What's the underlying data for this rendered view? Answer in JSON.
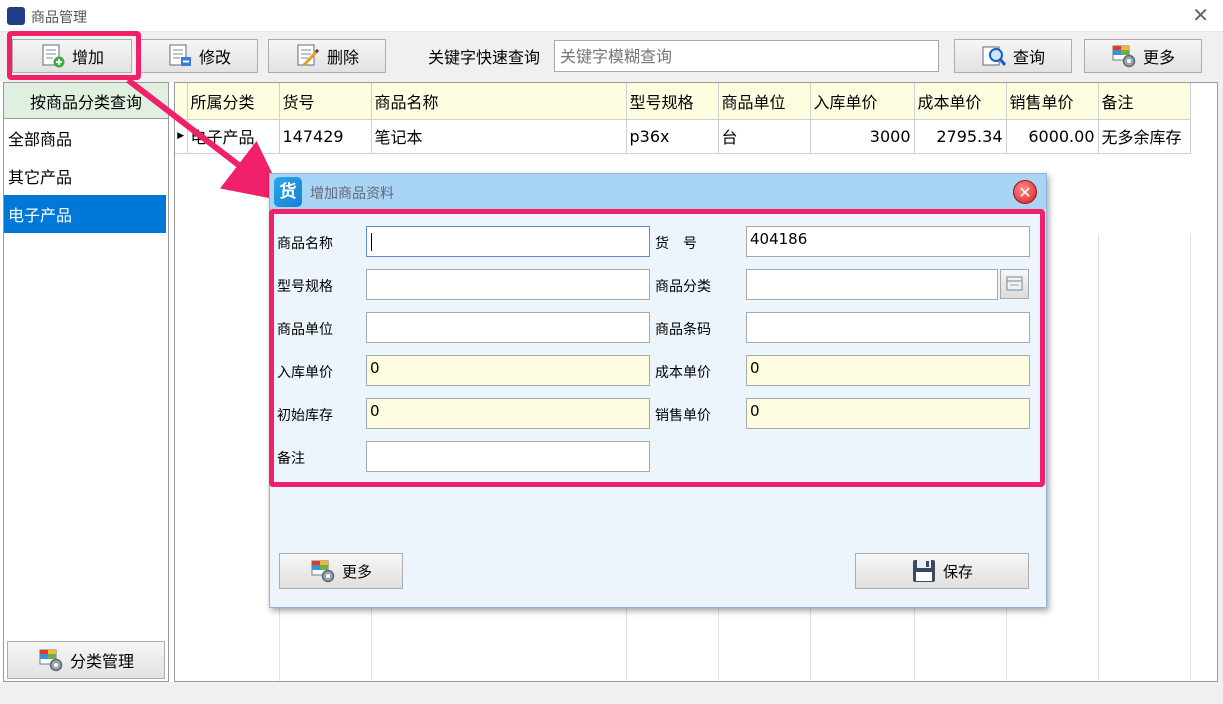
{
  "window": {
    "title": "商品管理",
    "close_glyph": "✕"
  },
  "toolbar": {
    "add_label": "增加",
    "edit_label": "修改",
    "delete_label": "删除",
    "keyword_label": "关键字快速查询",
    "keyword_placeholder": "关键字模糊查询",
    "query_label": "查询",
    "more_label": "更多"
  },
  "sidebar": {
    "header": "按商品分类查询",
    "items": [
      {
        "label": "全部商品",
        "selected": false
      },
      {
        "label": "其它产品",
        "selected": false
      },
      {
        "label": "电子产品",
        "selected": true
      }
    ],
    "footer_label": "分类管理"
  },
  "grid": {
    "columns": [
      "所属分类",
      "货号",
      "商品名称",
      "型号规格",
      "商品单位",
      "入库单价",
      "成本单价",
      "销售单价",
      "备注"
    ],
    "rows": [
      {
        "category": "电子产品",
        "code": "147429",
        "name": "笔记本",
        "spec": "p36x",
        "unit": "台",
        "in_price": "3000",
        "cost_price": "2795.34",
        "sale_price": "6000.00",
        "note": "无多余库存"
      }
    ]
  },
  "dialog": {
    "title": "增加商品资料",
    "icon_glyph": "货",
    "close_glyph": "✕",
    "fields": {
      "name_label": "商品名称",
      "name_value": "",
      "code_label": "货　号",
      "code_value": "404186",
      "spec_label": "型号规格",
      "spec_value": "",
      "category_label": "商品分类",
      "category_value": "",
      "unit_label": "商品单位",
      "unit_value": "",
      "barcode_label": "商品条码",
      "barcode_value": "",
      "in_price_label": "入库单价",
      "in_price_value": "0",
      "cost_price_label": "成本单价",
      "cost_price_value": "0",
      "initial_stock_label": "初始库存",
      "initial_stock_value": "0",
      "sale_price_label": "销售单价",
      "sale_price_value": "0",
      "note_label": "备注",
      "note_value": ""
    },
    "more_label": "更多",
    "save_label": "保存"
  },
  "colors": {
    "highlight": "#f0206a",
    "selection": "#0078d7",
    "grid_header": "#fffde0",
    "sidebar_header": "#e0f0e0",
    "dialog_title": "#a8d4f5"
  }
}
